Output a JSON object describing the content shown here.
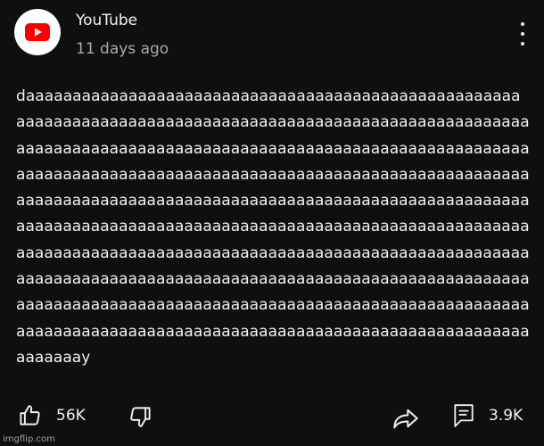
{
  "post": {
    "channel_name": "YouTube",
    "time_ago": "11 days ago",
    "text": "daaaaaaaaaaaaaaaaaaaaaaaaaaaaaaaaaaaaaaaaaaaaaaaaaaaaaaaaaaaaaaaaaaaaaaaaaaaaaaaaaaaaaaaaaaaaaaaaaaaaaaaaaaaaaaaaaaaaaaaaaaaaaaaaaaaaaaaaaaaaaaaaaaaaaaaaaaaaaaaaaaaaaaaaaaaaaaaaaaaaaaaaaaaaaaaaaaaaaaaaaaaaaaaaaaaaaaaaaaaaaaaaaaaaaaaaaaaaaaaaaaaaaaaaaaaaaaaaaaaaaaaaaaaaaaaaaaaaaaaaaaaaaaaaaaaaaaaaaaaaaaaaaaaaaaaaaaaaaaaaaaaaaaaaaaaaaaaaaaaaaaaaaaaaaaaaaaaaaaaaaaaaaaaaaaaaaaaaaaaaaaaaaaaaaaaaaaaaaaaaaaaaaaaaaaaaaaaaaaaaaaaaaaaaaaaaaaaaaaaaaaaaaaaaaaaaaaaaaaaaaaaaaaaaaaaaaaaaaaaaaaaaaaaaaaaaaaaaaaaaaaaaaaaaaaaaaaaaaaaaaaaaaaaaaaaaaaaaaaaaaaaaaaaaaaaaaaay"
  },
  "actions": {
    "like_count": "56K",
    "comment_count": "3.9K"
  },
  "watermark": "imgflip.com",
  "icons": {
    "avatar": "youtube-logo-icon",
    "menu": "more-vert-icon",
    "like": "thumb-up-icon",
    "dislike": "thumb-down-icon",
    "share": "share-icon",
    "comment": "comment-icon"
  },
  "colors": {
    "background": "#0f0f0f",
    "brand_red": "#ff0000",
    "text_primary": "#f1f1f1",
    "text_secondary": "#aaaaaa"
  }
}
